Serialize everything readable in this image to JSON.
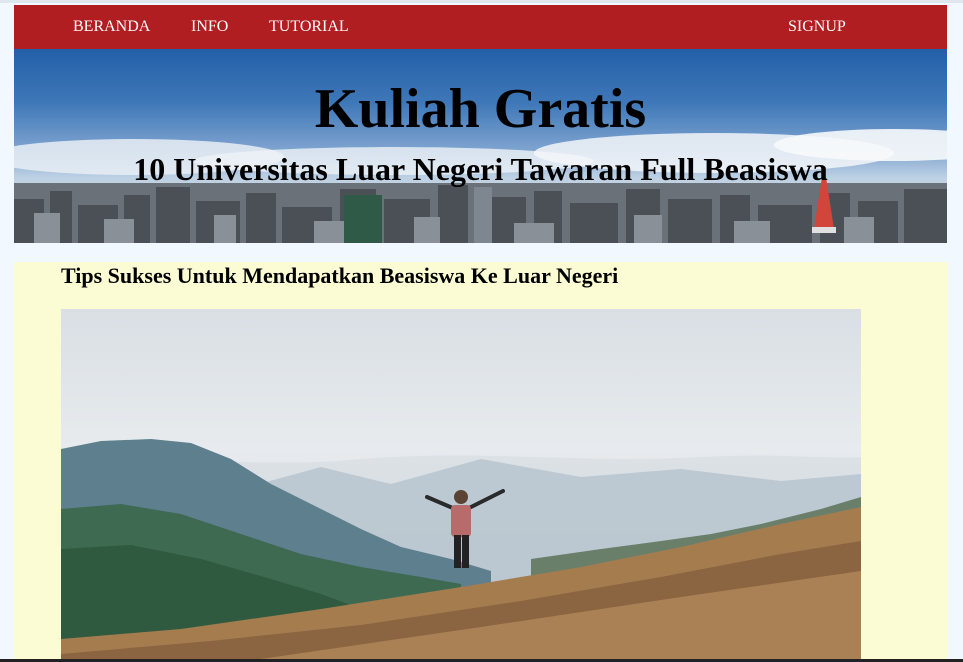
{
  "nav": {
    "links": [
      "BERANDA",
      "INFO",
      "TUTORIAL"
    ],
    "signup": "SIGNUP"
  },
  "hero": {
    "title": "Kuliah Gratis",
    "subtitle": "10 Universitas Luar Negeri Tawaran Full Beasiswa"
  },
  "article": {
    "title": "Tips Sukses Untuk Mendapatkan Beasiswa Ke Luar Negeri"
  },
  "colors": {
    "navbar": "#b11e22",
    "content_bg": "#fbfbd4",
    "page_bg": "#f1f8ff"
  },
  "icons": {
    "hero_image": "city-skyline-image",
    "article_image": "mountain-hiker-image"
  }
}
